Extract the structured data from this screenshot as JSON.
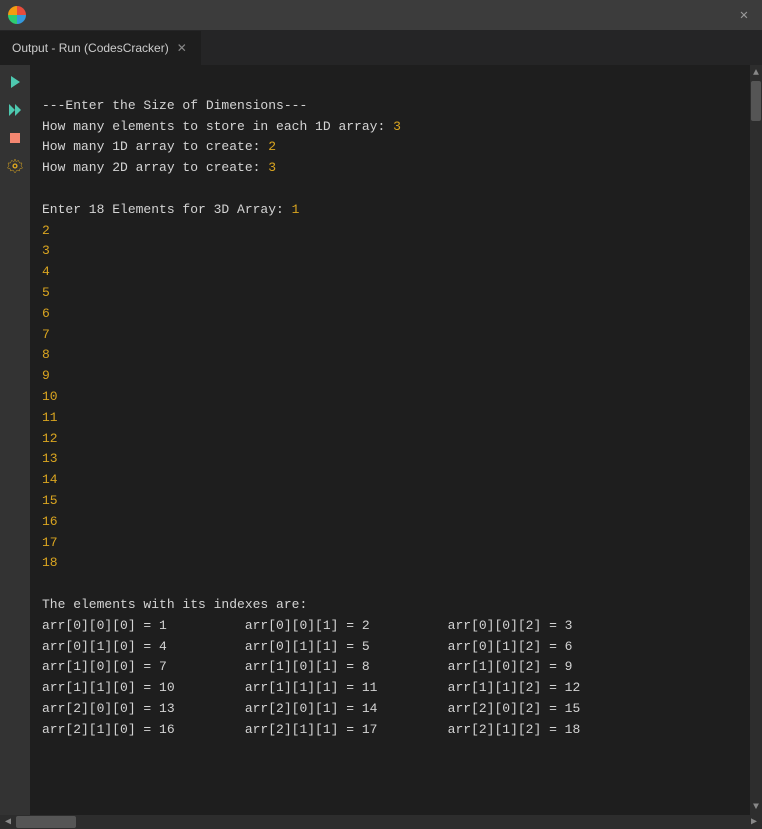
{
  "titlebar": {
    "close_label": "✕"
  },
  "tab": {
    "label": "Output - Run (CodesCracker)",
    "close": "✕"
  },
  "toolbar": {
    "play_icon": "▶",
    "play2_icon": "▶",
    "stop_icon": "■",
    "gear_icon": "⚙"
  },
  "output": {
    "lines": [
      {
        "type": "white",
        "text": "---Enter the Size of Dimensions---"
      },
      {
        "type": "mixed",
        "text": "How many elements to store in each 1D array: ",
        "value": "3",
        "value_color": "orange"
      },
      {
        "type": "mixed",
        "text": "How many 1D array to create: ",
        "value": "2",
        "value_color": "orange"
      },
      {
        "type": "mixed",
        "text": "How many 2D array to create: ",
        "value": "3",
        "value_color": "orange"
      },
      {
        "type": "blank"
      },
      {
        "type": "mixed",
        "text": "Enter 18 Elements for 3D Array: ",
        "value": "1",
        "value_color": "orange"
      },
      {
        "type": "yellow",
        "text": "2"
      },
      {
        "type": "yellow",
        "text": "3"
      },
      {
        "type": "yellow",
        "text": "4"
      },
      {
        "type": "yellow",
        "text": "5"
      },
      {
        "type": "yellow",
        "text": "6"
      },
      {
        "type": "yellow",
        "text": "7"
      },
      {
        "type": "yellow",
        "text": "8"
      },
      {
        "type": "yellow",
        "text": "9"
      },
      {
        "type": "yellow",
        "text": "10"
      },
      {
        "type": "yellow",
        "text": "11"
      },
      {
        "type": "yellow",
        "text": "12"
      },
      {
        "type": "yellow",
        "text": "13"
      },
      {
        "type": "yellow",
        "text": "14"
      },
      {
        "type": "yellow",
        "text": "15"
      },
      {
        "type": "yellow",
        "text": "16"
      },
      {
        "type": "yellow",
        "text": "17"
      },
      {
        "type": "yellow",
        "text": "18"
      },
      {
        "type": "blank"
      },
      {
        "type": "white",
        "text": "The elements with its indexes are:"
      }
    ],
    "table": [
      {
        "c1": "arr[0][0][0] = 1",
        "c2": "arr[0][0][1] = 2",
        "c3": "arr[0][0][2] = 3"
      },
      {
        "c1": "arr[0][1][0] = 4",
        "c2": "arr[0][1][1] = 5",
        "c3": "arr[0][1][2] = 6"
      },
      {
        "c1": "arr[1][0][0] = 7",
        "c2": "arr[1][0][1] = 8",
        "c3": "arr[1][0][2] = 9"
      },
      {
        "c1": "arr[1][1][0] = 10",
        "c2": "arr[1][1][1] = 11",
        "c3": "arr[1][1][2] = 12"
      },
      {
        "c1": "arr[2][0][0] = 13",
        "c2": "arr[2][0][1] = 14",
        "c3": "arr[2][0][2] = 15"
      },
      {
        "c1": "arr[2][1][0] = 16",
        "c2": "arr[2][1][1] = 17",
        "c3": "arr[2][1][2] = 18"
      }
    ]
  }
}
